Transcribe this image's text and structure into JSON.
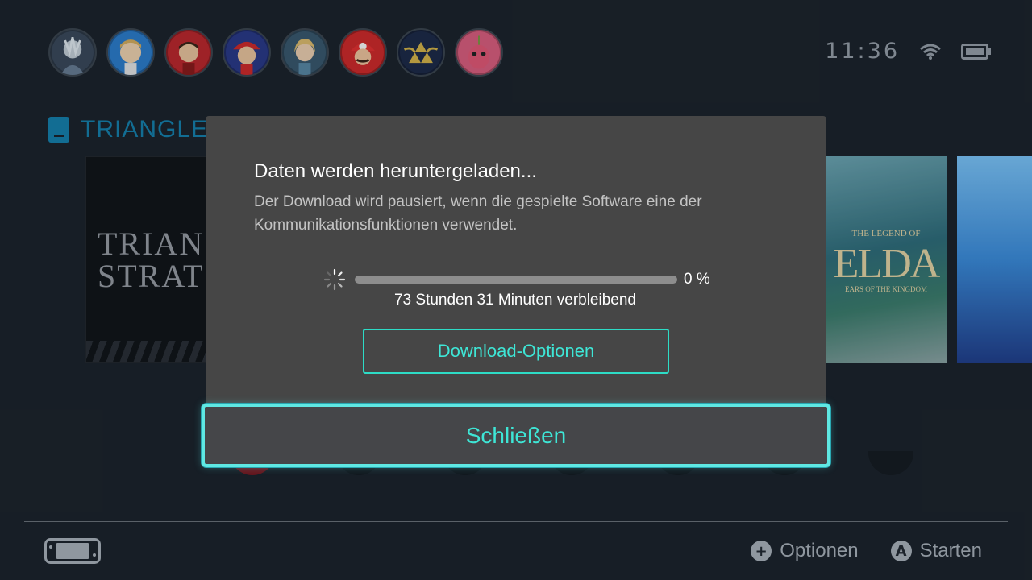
{
  "status": {
    "time": "11:36",
    "wifi_icon": "wifi-icon",
    "battery_icon": "battery-icon"
  },
  "avatars": [
    {
      "name": "user-avatar-1",
      "bg": "#3b4a5c"
    },
    {
      "name": "user-avatar-2",
      "bg": "#2d7fd0"
    },
    {
      "name": "user-avatar-3",
      "bg": "#c0282d"
    },
    {
      "name": "user-avatar-4",
      "bg": "#2a3a8a"
    },
    {
      "name": "user-avatar-5",
      "bg": "#3a5a70"
    },
    {
      "name": "user-avatar-6",
      "bg": "#d42a2a"
    },
    {
      "name": "user-avatar-7",
      "bg": "#1d2a48"
    },
    {
      "name": "user-avatar-8",
      "bg": "#e06080"
    }
  ],
  "shelf": {
    "title": "TRIANGLE S",
    "triangle_tile_text": "TRIAN\nSTRAT",
    "zelda_tile_line1": "THE LEGEND OF",
    "zelda_tile_line2": "ELDA",
    "zelda_tile_line3": "EARS OF THE KINGDOM"
  },
  "dialog": {
    "title": "Daten werden heruntergeladen...",
    "body": "Der Download wird pausiert, wenn die gespielte Software eine der Kommunikationsfunktionen verwendet.",
    "progress_percent": 0,
    "progress_label": "0 %",
    "remaining": "73 Stunden 31 Minuten verbleibend",
    "options_button": "Download-Optionen",
    "close_button": "Schließen"
  },
  "footer": {
    "options_icon": "+",
    "options_label": "Optionen",
    "start_icon": "A",
    "start_label": "Starten"
  },
  "colors": {
    "accent": "#3ee6d6",
    "background": "#1c232b",
    "dialog": "#464646",
    "shelf_title": "#1583b0"
  }
}
